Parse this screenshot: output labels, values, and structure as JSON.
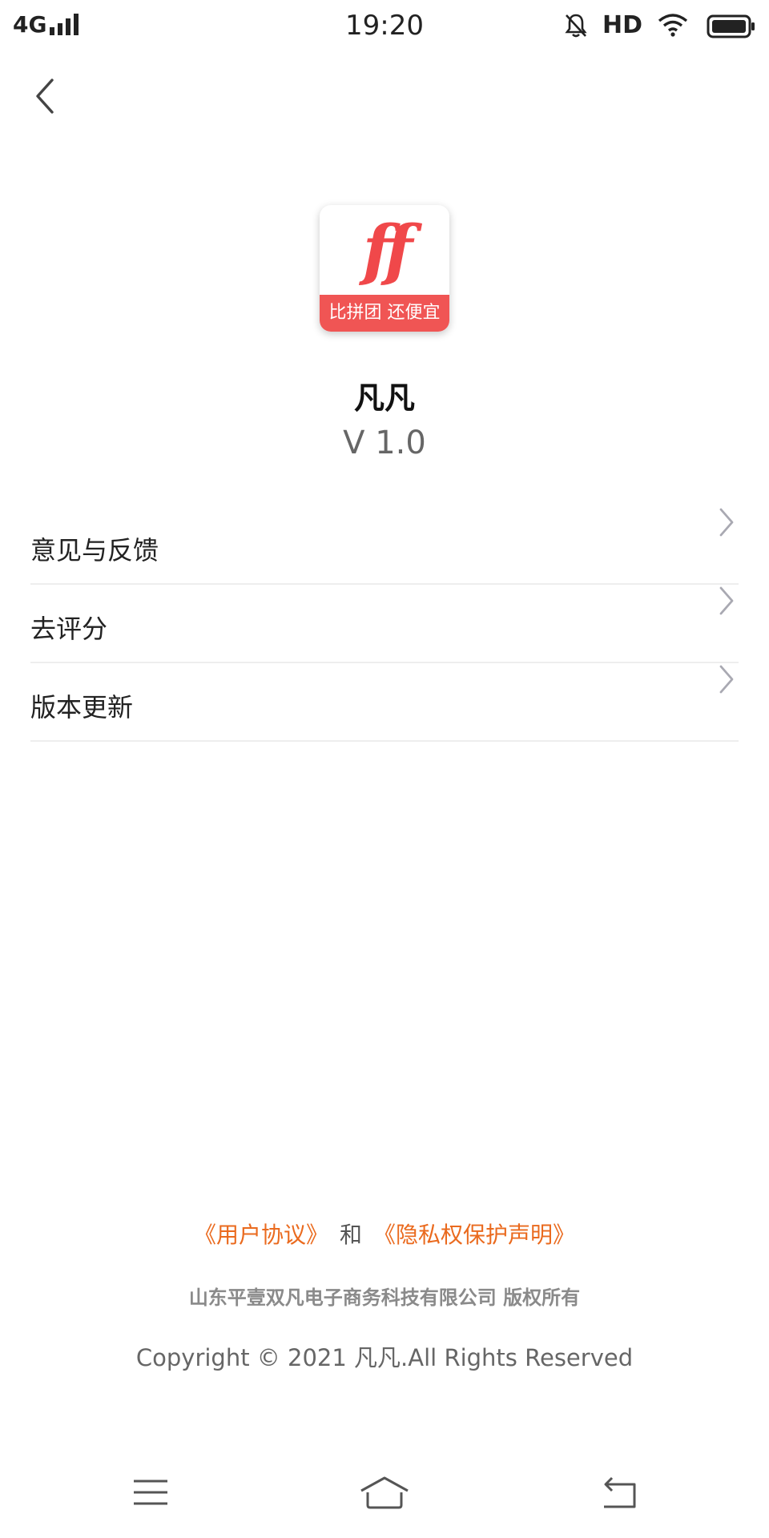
{
  "status_bar": {
    "carrier": "4G",
    "time": "19:20",
    "hd": "HD",
    "icons": [
      "signal-icon",
      "bell-off-icon",
      "wifi-icon",
      "battery-icon"
    ]
  },
  "nav": {
    "back_icon": "chevron-left-icon"
  },
  "app": {
    "logo": {
      "mark": "ff",
      "tagline": "比拼团 还便宜"
    },
    "name": "凡凡",
    "version": "V 1.0"
  },
  "menu": {
    "items": [
      {
        "label": "意见与反馈",
        "icon": "chevron-right-icon"
      },
      {
        "label": "去评分",
        "icon": "chevron-right-icon"
      },
      {
        "label": "版本更新",
        "icon": "chevron-right-icon"
      }
    ]
  },
  "footer": {
    "user_agreement": "《用户协议》",
    "connector": "和",
    "privacy_statement": "《隐私权保护声明》",
    "company": "山东平壹双凡电子商务科技有限公司 版权所有",
    "copyright": "Copyright © 2021 凡凡.All Rights Reserved"
  },
  "system_nav": {
    "icons": [
      "menu-icon",
      "home-icon",
      "back-icon"
    ]
  },
  "colors": {
    "accent_link": "#ea6a1e",
    "logo_red": "#f0484a",
    "divider": "#eeeeee",
    "muted_text": "#8a8a8a"
  }
}
